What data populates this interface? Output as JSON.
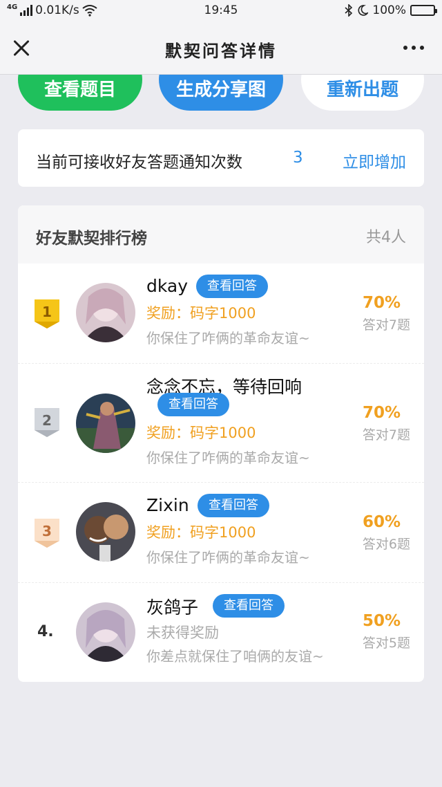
{
  "status_bar": {
    "signal": "4G",
    "speed": "0.01K/s",
    "time": "19:45",
    "battery": "100%",
    "icons": [
      "signal-icon",
      "wifi-icon",
      "bluetooth-icon",
      "moon-icon",
      "battery-icon"
    ]
  },
  "nav": {
    "title": "默契问答详情",
    "close_icon": "close-icon",
    "more_icon": "more-icon"
  },
  "actions": {
    "view_questions": "查看题目",
    "generate_share": "生成分享图",
    "reset_questions": "重新出题"
  },
  "notice": {
    "text": "当前可接收好友答题通知次数",
    "count": "3",
    "add_label": "立即增加"
  },
  "leaderboard": {
    "title": "好友默契排行榜",
    "total": "共4人",
    "view_answer_label": "查看回答",
    "entries": [
      {
        "rank": "1",
        "name": "dkay",
        "reward": "奖励：码字1000",
        "comment": "你保住了咋俩的革命友谊~",
        "percent": "70%",
        "correct": "答对7题"
      },
      {
        "rank": "2",
        "name": "念念不忘，等待回响",
        "reward": "奖励：码字1000",
        "comment": "你保住了咋俩的革命友谊~",
        "percent": "70%",
        "correct": "答对7题"
      },
      {
        "rank": "3",
        "name": "Zixin",
        "reward": "奖励：码字1000",
        "comment": "你保住了咋俩的革命友谊~",
        "percent": "60%",
        "correct": "答对6题"
      },
      {
        "rank": "4.",
        "name": "灰鸽子",
        "reward": "未获得奖励",
        "comment": "你差点就保住了咱俩的友谊~",
        "percent": "50%",
        "correct": "答对5题"
      }
    ]
  },
  "colors": {
    "green": "#1fc05c",
    "blue": "#2e8ee6",
    "orange": "#f0a020",
    "gold": "#f5c518",
    "silver": "#c8ccd2",
    "bronze": "#f8d4b4"
  }
}
